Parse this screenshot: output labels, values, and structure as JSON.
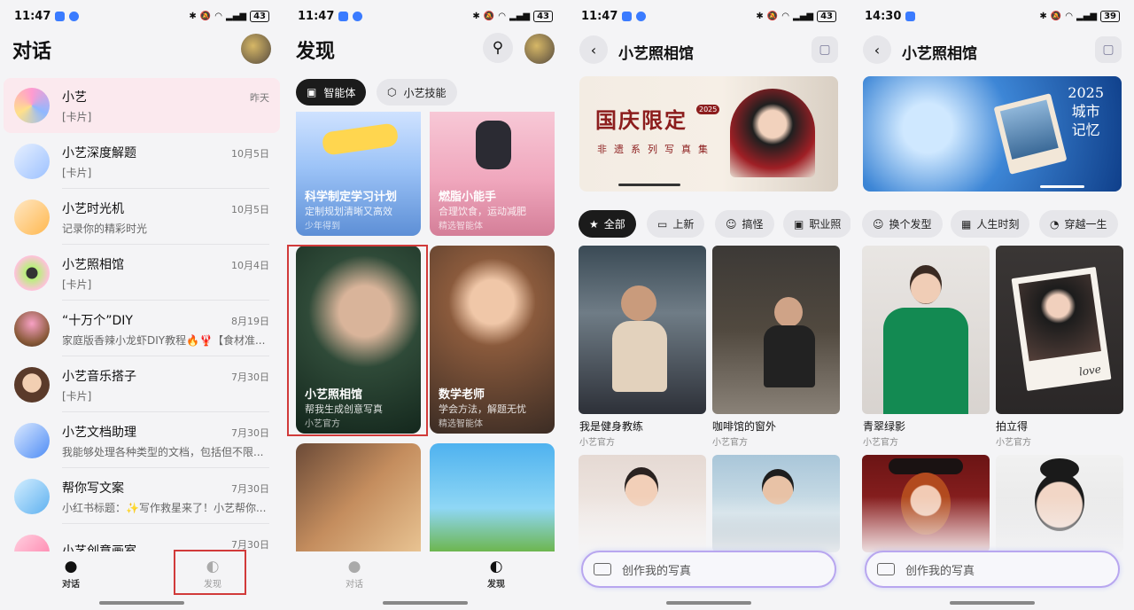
{
  "screen1": {
    "status": {
      "time": "11:47",
      "battery": "43"
    },
    "title": "对话",
    "chats": [
      {
        "name": "小艺",
        "sub": "[卡片]",
        "time": "昨天"
      },
      {
        "name": "小艺深度解题",
        "sub": "[卡片]",
        "time": "10月5日"
      },
      {
        "name": "小艺时光机",
        "sub": "记录你的精彩时光",
        "time": "10月5日"
      },
      {
        "name": "小艺照相馆",
        "sub": "[卡片]",
        "time": "10月4日"
      },
      {
        "name": "“十万个”DIY",
        "sub": "家庭版香辣小龙虾DIY教程🔥🦞【食材准...",
        "time": "8月19日"
      },
      {
        "name": "小艺音乐搭子",
        "sub": "[卡片]",
        "time": "7月30日"
      },
      {
        "name": "小艺文档助理",
        "sub": "我能够处理各种类型的文档，包括但不限...",
        "time": "7月30日"
      },
      {
        "name": "帮你写文案",
        "sub": "小红书标题：✨写作救星来了！小艺帮你...",
        "time": "7月30日"
      },
      {
        "name": "小艺创意画室",
        "sub": "",
        "time": "7月30日"
      }
    ],
    "tabs": {
      "chat": "对话",
      "discover": "发现"
    }
  },
  "screen2": {
    "status": {
      "time": "11:47",
      "battery": "43"
    },
    "title": "发现",
    "pills": {
      "agents": "智能体",
      "skills": "小艺技能"
    },
    "cards": [
      {
        "title": "科学制定学习计划",
        "sub": "定制规划清晰又高效",
        "foot": "少年得到"
      },
      {
        "title": "燃脂小能手",
        "sub": "合理饮食，运动减肥",
        "foot": "精选智能体"
      },
      {
        "title": "小艺照相馆",
        "sub": "帮我生成创意写真",
        "foot": "小艺官方"
      },
      {
        "title": "数学老师",
        "sub": "学会方法，解题无忧",
        "foot": "精选智能体"
      }
    ],
    "tabs": {
      "chat": "对话",
      "discover": "发现"
    }
  },
  "screen3": {
    "status": {
      "time": "11:47",
      "battery": "43"
    },
    "title": "小艺照相馆",
    "banner": {
      "headline": "国庆限定",
      "year": "2025",
      "sub": "非遗系列写真集"
    },
    "chips": [
      "全部",
      "上新",
      "搞怪",
      "职业照"
    ],
    "photos": [
      {
        "caption": "我是健身教练",
        "credit": "小艺官方"
      },
      {
        "caption": "咖啡馆的窗外",
        "credit": "小艺官方"
      }
    ],
    "create_placeholder": "创作我的写真"
  },
  "screen4": {
    "status": {
      "time": "14:30",
      "battery": "39"
    },
    "title": "小艺照相馆",
    "banner": {
      "line1": "2025",
      "line2": "城市",
      "line3": "记忆"
    },
    "chips": [
      "换个发型",
      "人生时刻",
      "穿越一生"
    ],
    "photos": [
      {
        "caption": "青翠绿影",
        "credit": "小艺官方"
      },
      {
        "caption": "拍立得",
        "credit": "小艺官方",
        "polaroid_text": "love"
      }
    ],
    "create_placeholder": "创作我的写真"
  },
  "icons": [
    "bluetooth-icon",
    "mute-icon",
    "wifi-icon",
    "signal-icon",
    "search-icon",
    "back-icon",
    "gallery-icon",
    "keyboard-icon",
    "chat-icon",
    "discover-icon",
    "star-icon"
  ]
}
